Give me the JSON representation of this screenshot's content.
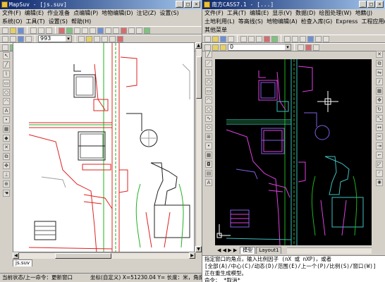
{
  "left_window": {
    "title": "MapSuv - [js.suv]",
    "menu": [
      "文件(F)",
      "编辑(E)",
      "作业准备",
      "点编辑(P)",
      "地物编辑(D)",
      "注记(Z)",
      "设置(S)"
    ],
    "menu2": [
      "系统(O)",
      "工具(T)",
      "设置(S)",
      "帮助(H)"
    ],
    "scale_value": "993",
    "tab_label": "js.suv",
    "status_left": "当前状态/上一命令：更新窗口",
    "status_right": "坐标(自定义) X=51230.04 Y= 长度：米，角度..."
  },
  "right_window": {
    "title": "南方CASS7.1 - [...]",
    "menu": [
      "文件(F)",
      "工具(T)",
      "编辑(E)",
      "显示(V)",
      "数据(D)",
      "绘图处理(W)",
      "地籍(J)"
    ],
    "menu2": [
      "土地利用(L)",
      "等高线(S)",
      "地物编辑(A)",
      "检查入库(G)",
      "Express",
      "工程应用(C)"
    ],
    "menu3": [
      "其他菜单"
    ],
    "layer_value": "0",
    "tabs": [
      "模型",
      "Layout1"
    ],
    "command_lines": [
      "指定窗口的角点，输入比例因子 (nX 或 nXP)，或者",
      "[全部(A)/中心(C)/动态(D)/范围(E)/上一个(P)/比例(S)/窗口(W)]",
      "正在重生成模型。",
      "命令： *取消*"
    ]
  },
  "colors": {
    "titlebar": "#0a246a",
    "chrome": "#d4d0c8",
    "left_canvas": "#ffffff",
    "right_canvas": "#000000",
    "map_red": "#e02020",
    "map_green": "#20b020",
    "map_cyan": "#40c0c0",
    "map_magenta": "#e040e0",
    "map_purple": "#8060e0"
  }
}
